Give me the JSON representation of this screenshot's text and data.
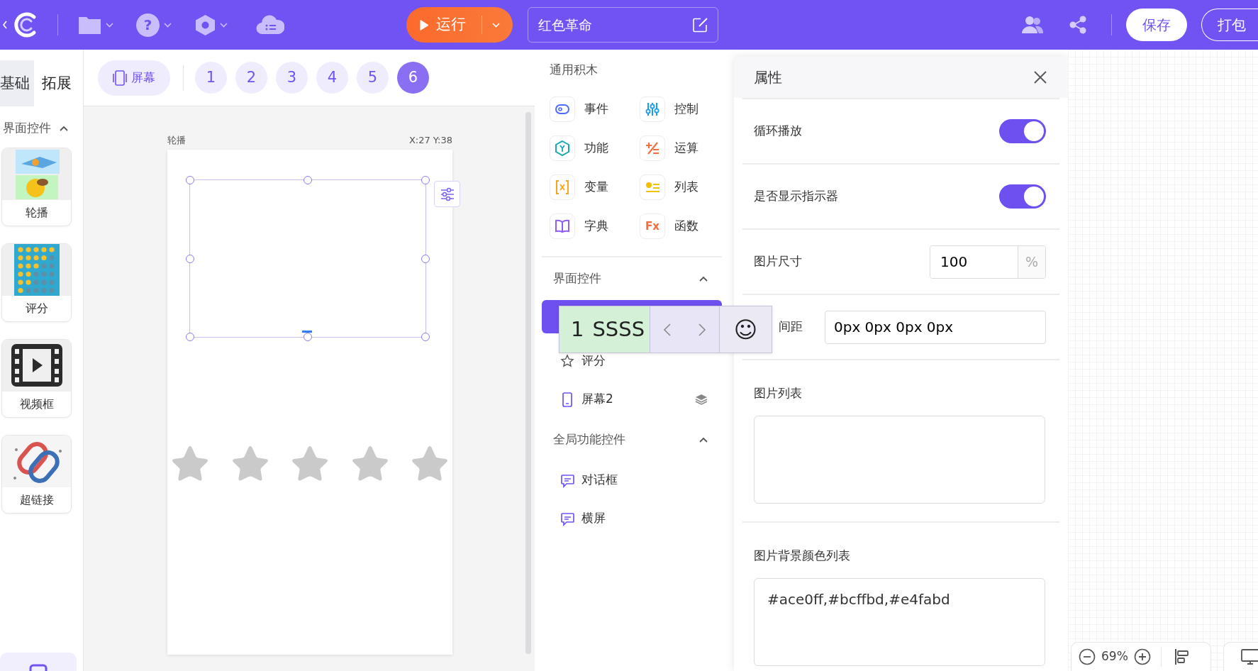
{
  "top_bar": {
    "help_glyph": "?",
    "run_button": "运行",
    "project_name": "红色革命",
    "save_button": "保存",
    "pack_button": "打包"
  },
  "sidebar": {
    "tabs": [
      {
        "label": "基础",
        "selected": false
      },
      {
        "label": "拓展",
        "selected": true
      }
    ],
    "section": {
      "title": "界面控件",
      "expanded": true
    },
    "items": [
      {
        "label": "轮播",
        "kind": "carousel"
      },
      {
        "label": "评分",
        "kind": "rating"
      },
      {
        "label": "视频框",
        "kind": "video"
      },
      {
        "label": "超链接",
        "kind": "link"
      }
    ]
  },
  "screen_bar": {
    "screen_button": "屏幕",
    "pages": [
      {
        "label": "1",
        "selected": false
      },
      {
        "label": "2",
        "selected": false
      },
      {
        "label": "3",
        "selected": false
      },
      {
        "label": "4",
        "selected": false
      },
      {
        "label": "5",
        "selected": false
      },
      {
        "label": "6",
        "selected": true
      }
    ]
  },
  "canvas": {
    "component_label": "轮播",
    "coords": "X:27 Y:38",
    "rating": {
      "stars": 0
    }
  },
  "blocks": {
    "title": "通用积木",
    "items": [
      {
        "label": "事件",
        "kind": "event"
      },
      {
        "label": "控制",
        "kind": "control"
      },
      {
        "label": "功能",
        "kind": "function"
      },
      {
        "label": "运算",
        "kind": "operator"
      },
      {
        "label": "变量",
        "kind": "variable"
      },
      {
        "label": "列表",
        "kind": "list"
      },
      {
        "label": "字典",
        "kind": "dictionary"
      },
      {
        "label": "函数",
        "kind": "fx",
        "icon_text": "Fx"
      }
    ],
    "groups": [
      {
        "title": "界面控件",
        "expanded": true,
        "items": [
          {
            "selected": true
          },
          {
            "label": "评分",
            "kind": "star",
            "selected": false
          },
          {
            "label": "屏幕2",
            "kind": "screen",
            "selected": false
          }
        ]
      },
      {
        "title": "全局功能控件",
        "expanded": true,
        "items": [
          {
            "label": "对话框",
            "kind": "dialog",
            "selected": false
          },
          {
            "label": "横屏",
            "kind": "dialog",
            "selected": false
          }
        ]
      }
    ]
  },
  "properties": {
    "title": "属性",
    "rows": [
      {
        "kind": "toggle",
        "label": "循环播放",
        "on": true
      },
      {
        "kind": "toggle",
        "label": "是否显示指示器",
        "on": true
      },
      {
        "kind": "number",
        "label": "图片尺寸",
        "value": "100",
        "unit": "%"
      },
      {
        "kind": "text",
        "label": "间距",
        "value": "0px 0px 0px 0px"
      },
      {
        "kind": "textarea",
        "label": "图片列表"
      },
      {
        "kind": "textarea",
        "label": "图片背景颜色列表",
        "value": "#ace0ff,#bcffbd,#e4fabd"
      }
    ]
  },
  "zoom": {
    "value": "69%"
  },
  "carousel_toolbar": {
    "index": "1",
    "text": "SSSS",
    "smiley": "☺"
  }
}
